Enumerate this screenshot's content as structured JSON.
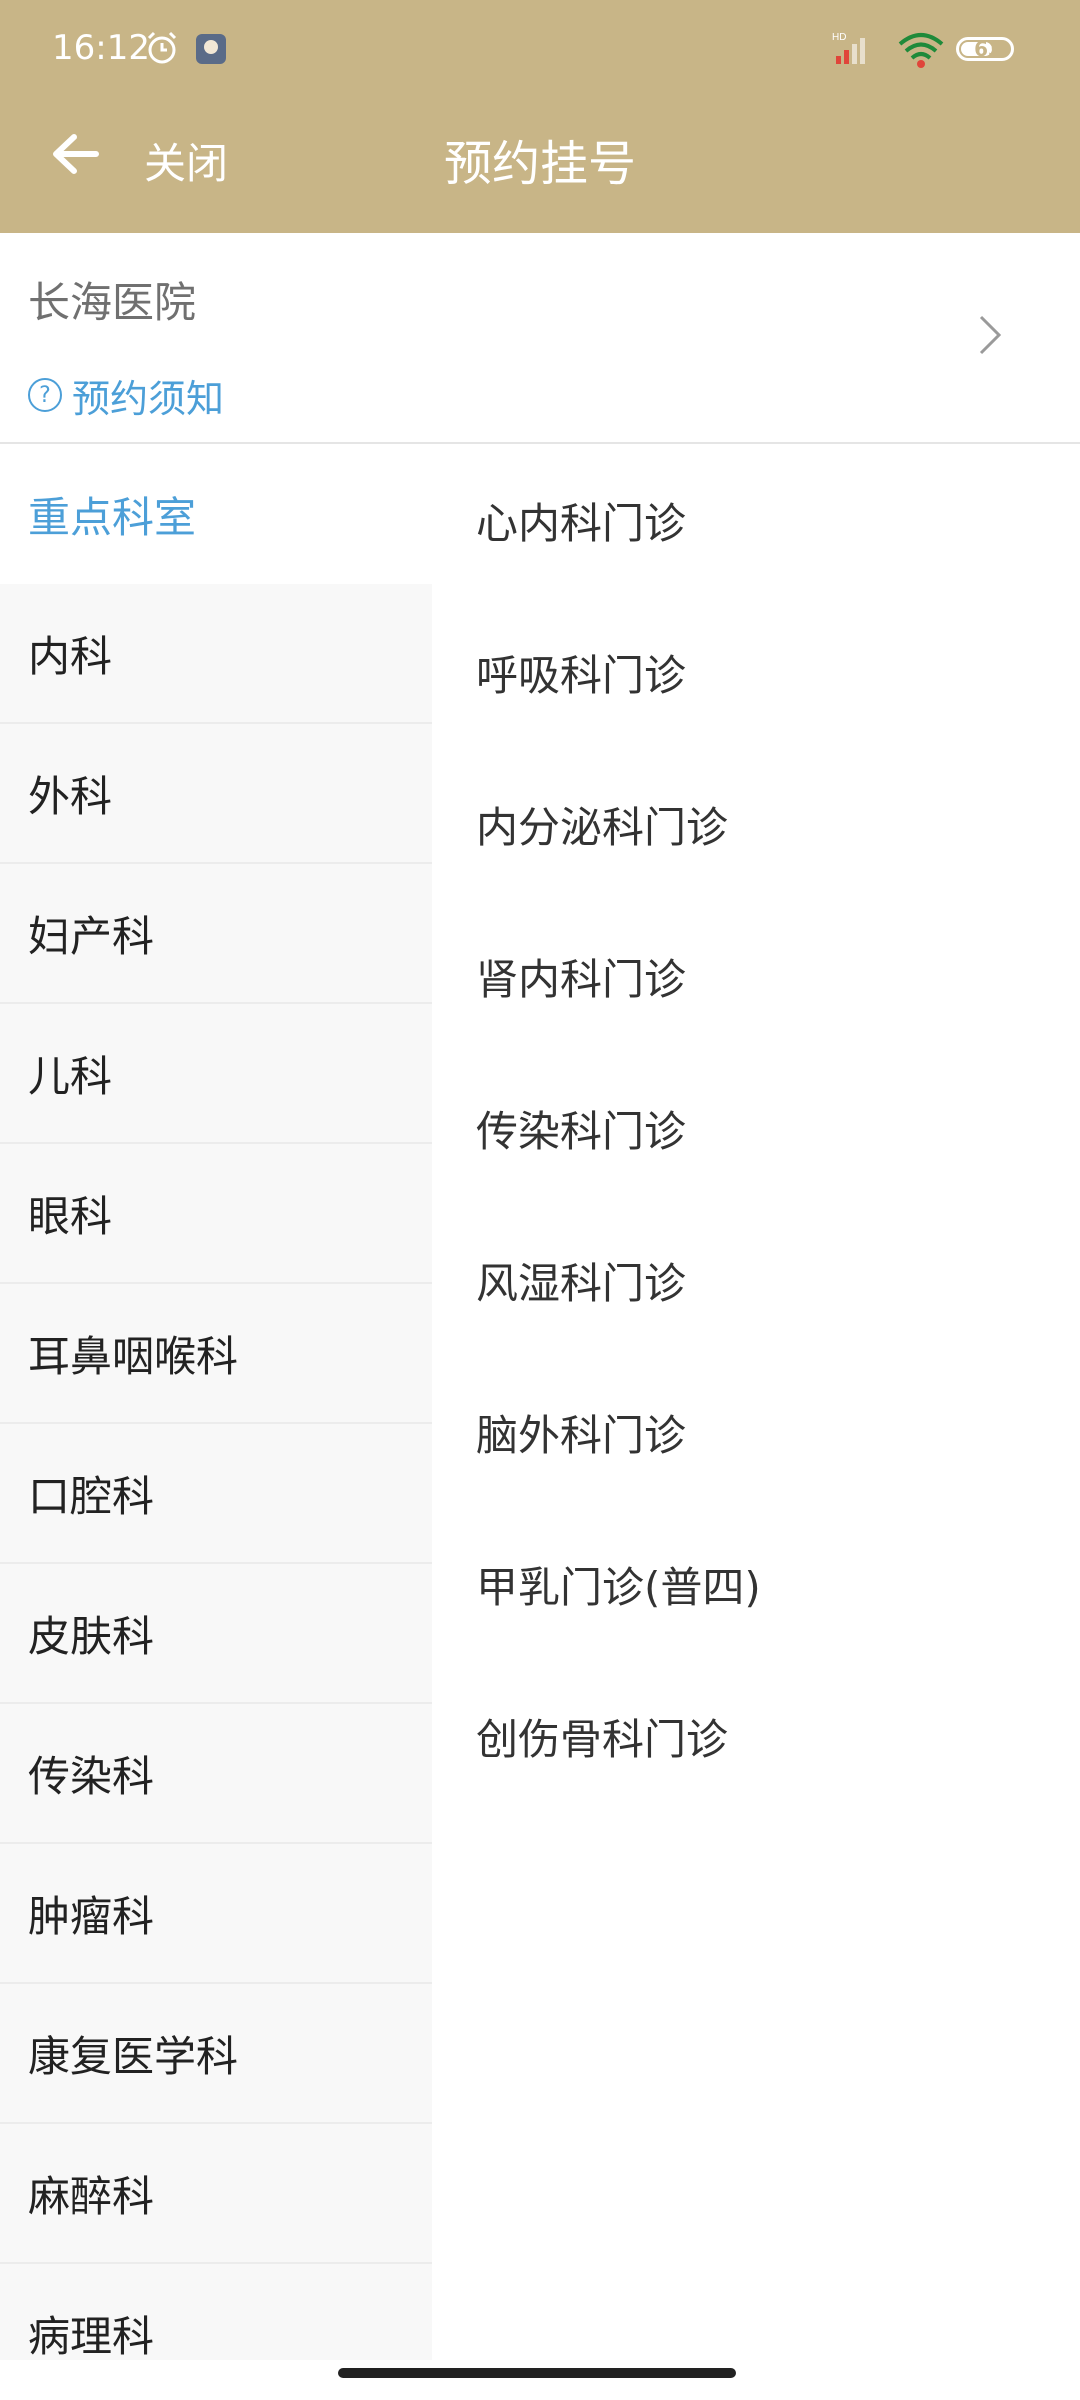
{
  "status_bar": {
    "time": "16:12",
    "battery": "63",
    "icons": [
      "alarm-icon",
      "app-badge-icon",
      "signal-icon",
      "wifi-icon",
      "battery-icon"
    ]
  },
  "header": {
    "close_label": "关闭",
    "title": "预约挂号",
    "background_color": "#c8b587"
  },
  "hospital": {
    "name": "长海医院",
    "notice_label": "预约须知",
    "accent_color": "#4c9fd8"
  },
  "categories": [
    "重点科室",
    "内科",
    "外科",
    "妇产科",
    "儿科",
    "眼科",
    "耳鼻咽喉科",
    "口腔科",
    "皮肤科",
    "传染科",
    "肿瘤科",
    "康复医学科",
    "麻醉科",
    "病理科"
  ],
  "selected_category": "重点科室",
  "departments": [
    "心内科门诊",
    "呼吸科门诊",
    "内分泌科门诊",
    "肾内科门诊",
    "传染科门诊",
    "风湿科门诊",
    "脑外科门诊",
    "甲乳门诊(普四)",
    "创伤骨科门诊"
  ]
}
